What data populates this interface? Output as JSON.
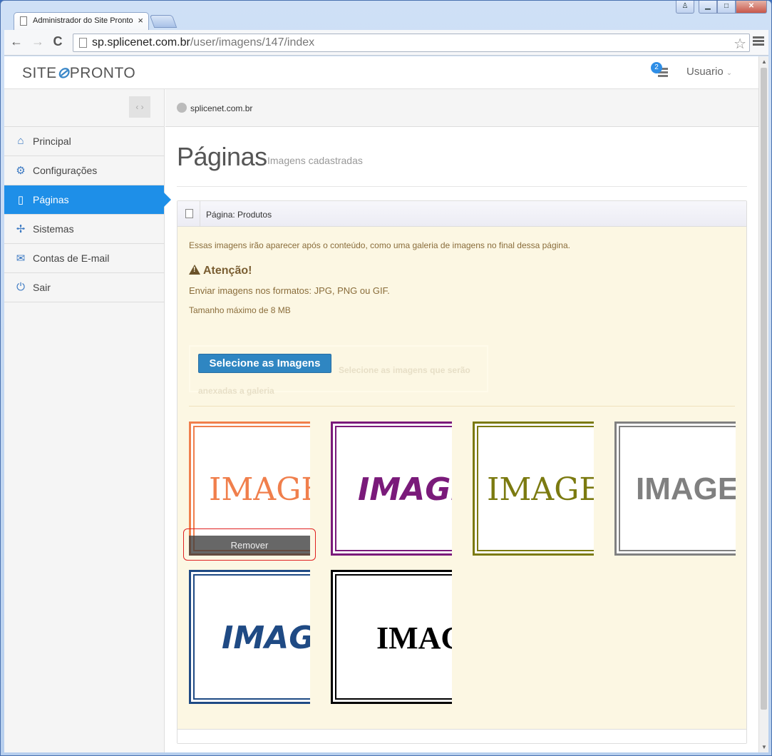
{
  "browser": {
    "tab_title": "Administrador do Site Pronto",
    "tab_close": "×",
    "url_host": "sp.splicenet.com.br",
    "url_path": "/user/imagens/147/index",
    "back": "←",
    "forward": "→",
    "reload": "C",
    "star": "☆",
    "window_user": "♙",
    "window_min": "▁",
    "window_max": "□",
    "window_close": "✕"
  },
  "header": {
    "logo_left": "SITE",
    "logo_clip": "⊘",
    "logo_right": "PRONTO",
    "notifications_count": "2",
    "user_menu": "Usuario",
    "user_caret": "⌄"
  },
  "sidebar": {
    "collapse": "‹ ›",
    "items": [
      {
        "label": "Principal",
        "icon": "⌂",
        "icon_name": "home-icon"
      },
      {
        "label": "Configurações",
        "icon": "⚙",
        "icon_name": "gear-icon"
      },
      {
        "label": "Páginas",
        "icon": "▯",
        "icon_name": "page-icon"
      },
      {
        "label": "Sistemas",
        "icon": "✢",
        "icon_name": "puzzle-icon"
      },
      {
        "label": "Contas de E-mail",
        "icon": "✉",
        "icon_name": "envelope-icon"
      },
      {
        "label": "Sair",
        "icon": "⏻",
        "icon_name": "power-icon"
      }
    ],
    "active_index": 2
  },
  "breadcrumb": {
    "site": "splicenet.com.br"
  },
  "page": {
    "title": "Páginas",
    "subtitle": "Imagens cadastradas"
  },
  "panel": {
    "heading": "Página: Produtos",
    "info": "Essas imagens irão aparecer após o conteúdo, como uma galeria de imagens no final dessa página.",
    "attention_title": "Atenção!",
    "attention_formats": "Enviar imagens nos formatos: JPG, PNG ou GIF.",
    "attention_size": "Tamanho máximo de 8 MB",
    "upload_button": "Selecione as Imagens",
    "upload_hint": "Selecione as imagens que serão anexadas a galeria"
  },
  "gallery": {
    "remove_label": "Remover",
    "images": [
      {
        "text": "IMAGEM",
        "color": "#f07f4c",
        "style": "script"
      },
      {
        "text": "IMAGEM",
        "color": "#7a1a7a",
        "style": "brush"
      },
      {
        "text": "IMAGEM",
        "color": "#7b7a10",
        "style": "script"
      },
      {
        "text": "IMAGEM",
        "color": "#808080",
        "style": "bold"
      },
      {
        "text": "IMAGEM",
        "color": "#1f4a84",
        "style": "brush"
      },
      {
        "text": "IMAGEM",
        "color": "#000000",
        "style": "western"
      }
    ]
  },
  "colors": {
    "accent": "#1e8fe8",
    "warning_bg": "#fcf7e3",
    "warning_text": "#8a6d3b",
    "upload_button": "#2f86c2",
    "highlight": "#e02020"
  }
}
